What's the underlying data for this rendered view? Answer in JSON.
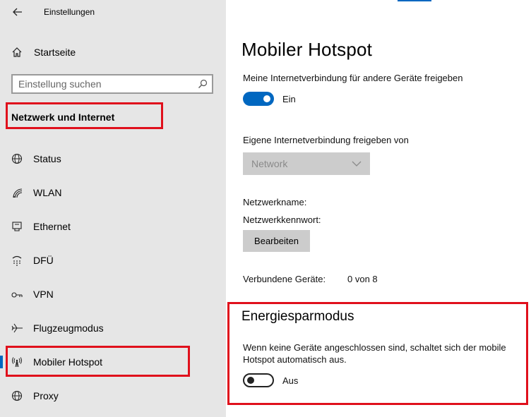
{
  "window": {
    "title": "Einstellungen"
  },
  "sidebar": {
    "home_label": "Startseite",
    "search_placeholder": "Einstellung suchen",
    "section_heading": "Netzwerk und Internet",
    "items": [
      {
        "label": "Status",
        "icon": "globe-icon"
      },
      {
        "label": "WLAN",
        "icon": "wifi-icon"
      },
      {
        "label": "Ethernet",
        "icon": "ethernet-icon"
      },
      {
        "label": "DFÜ",
        "icon": "dialup-icon"
      },
      {
        "label": "VPN",
        "icon": "vpn-icon"
      },
      {
        "label": "Flugzeugmodus",
        "icon": "airplane-icon"
      },
      {
        "label": "Mobiler Hotspot",
        "icon": "hotspot-icon",
        "selected": true
      },
      {
        "label": "Proxy",
        "icon": "globe-icon"
      }
    ]
  },
  "main": {
    "title": "Mobiler Hotspot",
    "share_label": "Meine Internetverbindung für andere Geräte freigeben",
    "share_toggle": {
      "state": "on",
      "label": "Ein"
    },
    "share_from_label": "Eigene Internetverbindung freigeben von",
    "share_from_value": "Network",
    "network_name_label": "Netzwerkname:",
    "network_password_label": "Netzwerkkennwort:",
    "edit_button": "Bearbeiten",
    "connected_devices_label": "Verbundene Geräte:",
    "connected_devices_value": "0 von 8",
    "power_saving": {
      "title": "Energiesparmodus",
      "description_line1": "Wenn keine Geräte angeschlossen sind, schaltet sich der mobile",
      "description_line2": "Hotspot automatisch aus.",
      "toggle": {
        "state": "off",
        "label": "Aus"
      }
    }
  },
  "colors": {
    "accent": "#0067c0",
    "highlight_box": "#e0101c",
    "sidebar_bg": "#e6e6e6"
  }
}
